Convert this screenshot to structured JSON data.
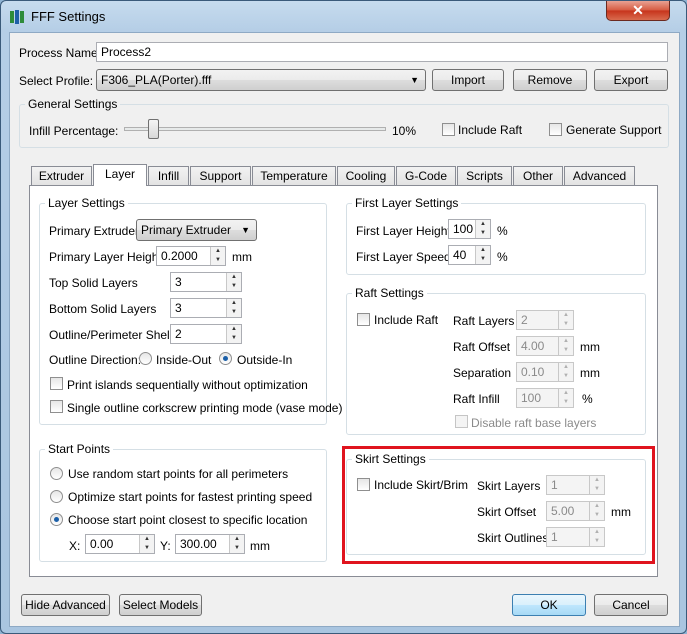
{
  "window": {
    "title": "FFF Settings",
    "close_label": "✕"
  },
  "process": {
    "name_label": "Process Name:",
    "name_value": "Process2"
  },
  "profile": {
    "label": "Select Profile:",
    "selected": "F306_PLA(Porter).fff",
    "import_label": "Import",
    "remove_label": "Remove",
    "export_label": "Export"
  },
  "general": {
    "title": "General Settings",
    "infill_label": "Infill Percentage:",
    "infill_value": "10%",
    "infill_level": 0.1,
    "include_raft_label": "Include Raft",
    "generate_support_label": "Generate Support"
  },
  "tabs": [
    "Extruder",
    "Layer",
    "Infill",
    "Support",
    "Temperature",
    "Cooling",
    "G-Code",
    "Scripts",
    "Other",
    "Advanced"
  ],
  "active_tab": "Layer",
  "layer_settings": {
    "title": "Layer Settings",
    "primary_extruder_label": "Primary Extruder",
    "primary_extruder_value": "Primary Extruder",
    "primary_layer_height_label": "Primary Layer Height",
    "primary_layer_height_value": "0.2000",
    "mm": "mm",
    "top_solid_layers_label": "Top Solid Layers",
    "top_solid_layers_value": "3",
    "bottom_solid_layers_label": "Bottom Solid Layers",
    "bottom_solid_layers_value": "3",
    "outline_shells_label": "Outline/Perimeter Shells",
    "outline_shells_value": "2",
    "outline_direction_label": "Outline Direction:",
    "inside_out_label": "Inside-Out",
    "outside_in_label": "Outside-In",
    "print_islands_label": "Print islands sequentially without optimization",
    "single_outline_label": "Single outline corkscrew printing mode (vase mode)"
  },
  "start_points": {
    "title": "Start Points",
    "random_label": "Use random start points for all perimeters",
    "optimize_label": "Optimize start points for fastest printing speed",
    "closest_label": "Choose start point closest to specific location",
    "x_label": "X:",
    "x_value": "0.00",
    "y_label": "Y:",
    "y_value": "300.00",
    "mm": "mm"
  },
  "first_layer": {
    "title": "First Layer Settings",
    "height_label": "First Layer Height",
    "height_value": "100",
    "pct": "%",
    "speed_label": "First Layer Speed",
    "speed_value": "40"
  },
  "raft": {
    "title": "Raft Settings",
    "include_label": "Include Raft",
    "layers_label": "Raft Layers",
    "layers_value": "2",
    "offset_label": "Raft Offset",
    "offset_value": "4.00",
    "mm": "mm",
    "separation_label": "Separation",
    "separation_value": "0.10",
    "infill_label": "Raft Infill",
    "infill_value": "100",
    "pct": "%",
    "disable_label": "Disable raft base layers"
  },
  "skirt": {
    "title": "Skirt Settings",
    "include_label": "Include Skirt/Brim",
    "layers_label": "Skirt Layers",
    "layers_value": "1",
    "offset_label": "Skirt Offset",
    "offset_value": "5.00",
    "mm": "mm",
    "outlines_label": "Skirt Outlines",
    "outlines_value": "1"
  },
  "footer": {
    "hide_advanced_label": "Hide Advanced",
    "select_models_label": "Select Models",
    "ok_label": "OK",
    "cancel_label": "Cancel"
  },
  "colors": {
    "highlight": "#e0141e",
    "title_bar": "#b5cee6",
    "close_button": "#c7331b"
  }
}
